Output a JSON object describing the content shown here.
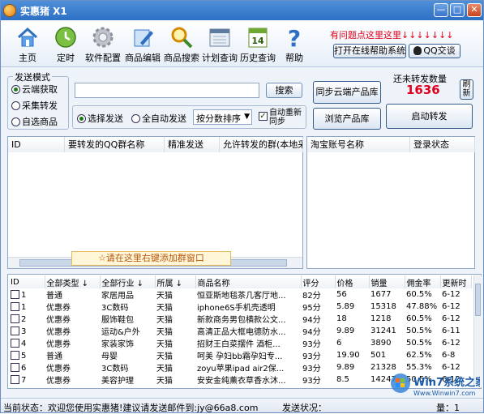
{
  "window": {
    "title": "实惠猪 X1",
    "minimize": "—",
    "maximize": "□",
    "close": "✕"
  },
  "toolbar": {
    "items": [
      {
        "label": "主页",
        "icon": "home-icon"
      },
      {
        "label": "定时",
        "icon": "clock-icon"
      },
      {
        "label": "软件配置",
        "icon": "gear-icon"
      },
      {
        "label": "商品编辑",
        "icon": "edit-icon"
      },
      {
        "label": "商品搜索",
        "icon": "magnifier-icon"
      },
      {
        "label": "计划查询",
        "icon": "calendar-icon"
      },
      {
        "label": "历史查询",
        "icon": "calendar-14-icon"
      },
      {
        "label": "帮助",
        "icon": "help-icon"
      }
    ],
    "calendar_day": "14",
    "help_text": "有问题点这里这里↓↓↓↓↓↓↓",
    "online_help": "打开在线帮助系统",
    "qq_label": "QQ交谈"
  },
  "send_mode": {
    "title": "发送模式",
    "options": [
      "云端获取",
      "采集转发",
      "自选商品"
    ],
    "selected": 0
  },
  "search": {
    "value": "",
    "button": "搜索"
  },
  "options": {
    "choose_send": "选择发送",
    "auto_send": "全自动发送",
    "sort": "按分数排序",
    "auto_resync": "自动重新同步"
  },
  "buttons": {
    "sync_cloud": "同步云端产品库",
    "browse": "浏览产品库",
    "start_forward": "启动转发",
    "refresh": "刷新"
  },
  "counter": {
    "label": "还未转发数量",
    "value": "1636"
  },
  "left_panel": {
    "columns": [
      "ID",
      "要转发的QQ群名称",
      "精准发送",
      "允许转发的群(本地采"
    ]
  },
  "right_panel": {
    "columns": [
      "淘宝账号名称",
      "登录状态"
    ]
  },
  "hint": "☆请在这里右键添加群窗口",
  "table": {
    "columns": [
      "ID",
      "全部类型 ↓",
      "全部行业 ↓",
      "所属 ↓",
      "商品名称",
      "评分",
      "价格",
      "销量",
      "佣金率",
      "更新时"
    ],
    "rows": [
      [
        "1",
        "普通",
        "家居用品",
        "天猫",
        "恒亚斯地毯茶几客厅地...",
        "82分",
        "56",
        "1677",
        "60.5%",
        "6-12"
      ],
      [
        "1",
        "优惠券",
        "3C数码",
        "天猫",
        "iphone6S手机壳透明",
        "95分",
        "5.89",
        "15318",
        "47.88%",
        "6-12"
      ],
      [
        "2",
        "优惠券",
        "服饰鞋包",
        "天猫",
        "新款商务男包横款公文...",
        "94分",
        "18",
        "1218",
        "60.5%",
        "6-12"
      ],
      [
        "3",
        "优惠券",
        "运动&户外",
        "天猫",
        "高清正品大框电德防水...",
        "94分",
        "9.89",
        "31241",
        "50.5%",
        "6-11"
      ],
      [
        "4",
        "优惠券",
        "家装家饰",
        "天猫",
        "招财王白菜摆件 酒柜...",
        "93分",
        "6",
        "3890",
        "50.5%",
        "6-12"
      ],
      [
        "5",
        "普通",
        "母婴",
        "天猫",
        "呵美 孕妇bb霜孕妇专...",
        "93分",
        "19.90",
        "501",
        "62.5%",
        "6-8"
      ],
      [
        "6",
        "优惠券",
        "3C数码",
        "天猫",
        "zoyu苹果ipad air2保...",
        "93分",
        "9.89",
        "21328",
        "55.3%",
        "6-12"
      ],
      [
        "7",
        "优惠券",
        "美容护理",
        "天猫",
        "安安金纯薰衣草香水沐...",
        "93分",
        "8.5",
        "14247",
        "50.5%",
        "6-12"
      ]
    ]
  },
  "status": {
    "current": "当前状态：欢迎您使用实惠猪!建议请发送邮件到:jy@66a8.com",
    "send": "发送状况：",
    "concurrency": "量：1"
  },
  "watermark": {
    "text": "Win7系统之家",
    "url": "Www.Winwin7.com"
  }
}
